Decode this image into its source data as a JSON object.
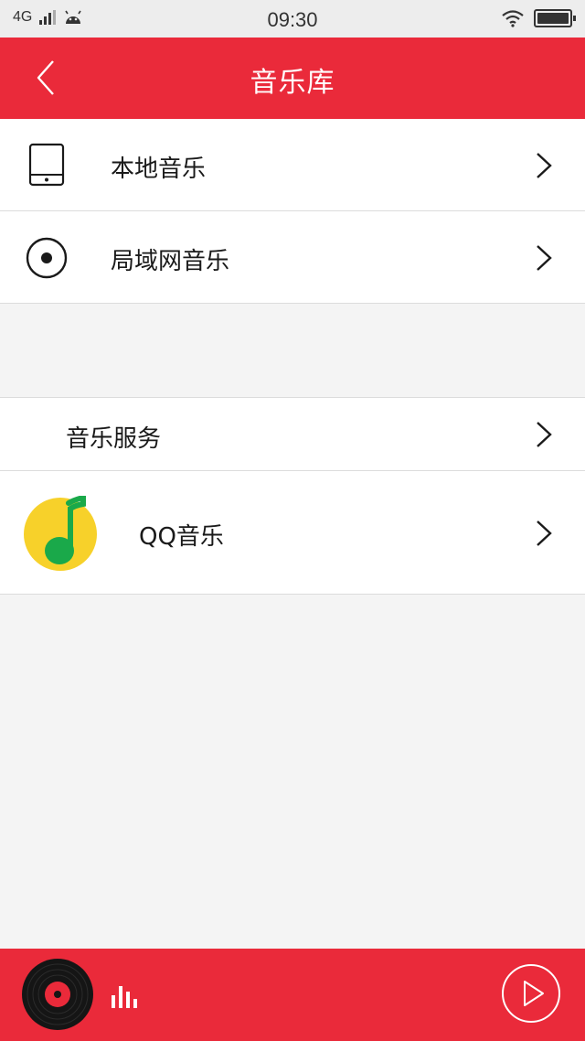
{
  "status_bar": {
    "network": "4G",
    "time": "09:30"
  },
  "header": {
    "title": "音乐库"
  },
  "sources": [
    {
      "label": "本地音乐",
      "icon": "tablet-icon"
    },
    {
      "label": "局域网音乐",
      "icon": "radio-target-icon"
    }
  ],
  "services": {
    "header_label": "音乐服务",
    "items": [
      {
        "label": "QQ音乐",
        "icon": "qq-music-logo-icon"
      }
    ]
  },
  "colors": {
    "accent": "#ea2a3a",
    "background": "#f4f4f4",
    "qq_yellow": "#f7d12a",
    "qq_green": "#1aa94a"
  }
}
